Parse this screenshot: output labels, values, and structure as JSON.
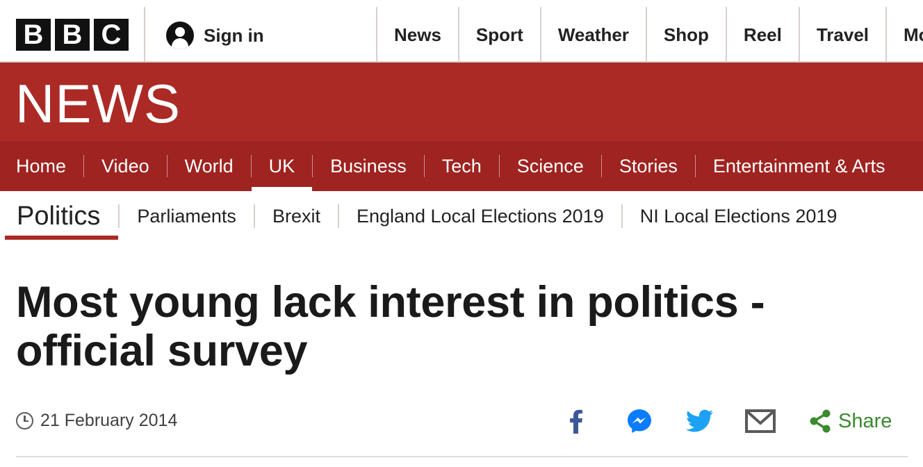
{
  "brand": {
    "logo_letters": [
      "B",
      "B",
      "C"
    ]
  },
  "account": {
    "signin_label": "Sign in"
  },
  "top_nav": {
    "items": [
      "News",
      "Sport",
      "Weather",
      "Shop",
      "Reel",
      "Travel",
      "Mo"
    ]
  },
  "banner": {
    "title": "NEWS",
    "color": "#ab2a25"
  },
  "section_nav": {
    "items": [
      "Home",
      "Video",
      "World",
      "UK",
      "Business",
      "Tech",
      "Science",
      "Stories",
      "Entertainment & Arts"
    ],
    "active": "UK"
  },
  "sub_nav": {
    "primary": "Politics",
    "items": [
      "Parliaments",
      "Brexit",
      "England Local Elections 2019",
      "NI Local Elections 2019"
    ]
  },
  "article": {
    "headline_line1": "Most young lack interest in politics -",
    "headline_line2": "official survey",
    "date": "21 February 2014"
  },
  "share": {
    "icons": [
      "facebook-icon",
      "messenger-icon",
      "twitter-icon",
      "email-icon",
      "share-icon"
    ],
    "label": "Share",
    "colors": {
      "facebook": "#3b5998",
      "messenger": "#0084ff",
      "twitter": "#1da1f2",
      "email": "#5a5a5a",
      "share": "#3a8a2e"
    }
  }
}
